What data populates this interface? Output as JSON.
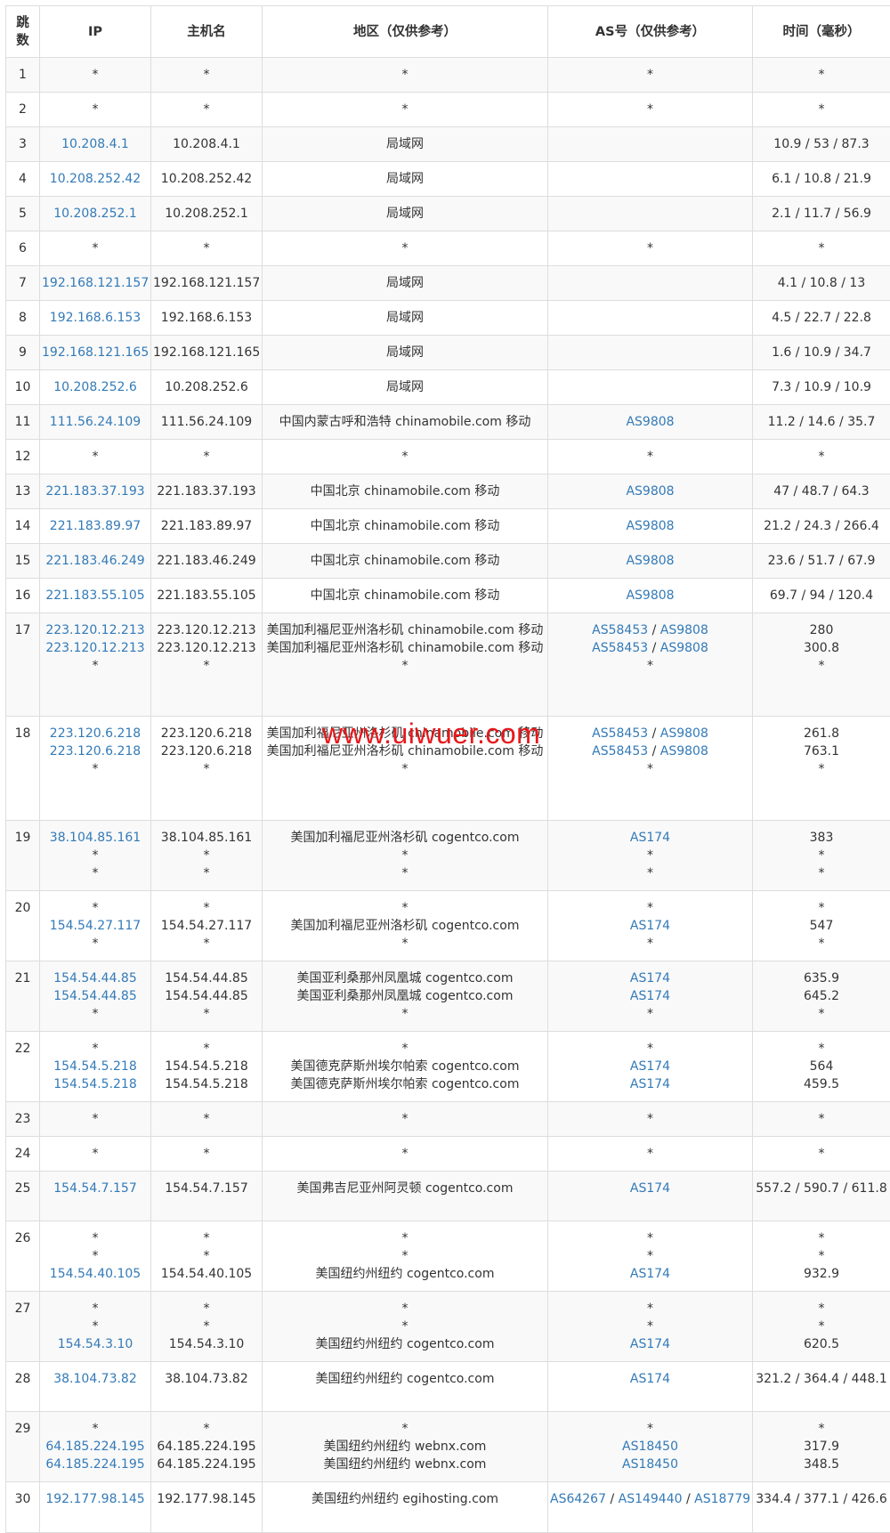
{
  "headers": {
    "hop": "跳数",
    "ip": "IP",
    "hostname": "主机名",
    "region": "地区（仅供参考）",
    "asn": "AS号（仅供参考）",
    "time": "时间（毫秒）"
  },
  "watermark": "www.uiwuer.com",
  "colors": {
    "link": "#337ab7",
    "border": "#dddddd",
    "stripe": "#f9f9f9",
    "watermark": "#e8181b"
  },
  "rows": [
    {
      "hop": "1",
      "h": 36,
      "ip": [
        "*"
      ],
      "host": [
        "*"
      ],
      "region": [
        "*"
      ],
      "as": [
        [
          "*"
        ]
      ],
      "time": [
        "*"
      ]
    },
    {
      "hop": "2",
      "h": 36,
      "ip": [
        "*"
      ],
      "host": [
        "*"
      ],
      "region": [
        "*"
      ],
      "as": [
        [
          "*"
        ]
      ],
      "time": [
        "*"
      ]
    },
    {
      "hop": "3",
      "h": 36,
      "ip": [
        "10.208.4.1"
      ],
      "host": [
        "10.208.4.1"
      ],
      "region": [
        "局域网"
      ],
      "as": [
        []
      ],
      "time": [
        "10.9 / 53 / 87.3"
      ]
    },
    {
      "hop": "4",
      "h": 36,
      "ip": [
        "10.208.252.42"
      ],
      "host": [
        "10.208.252.42"
      ],
      "region": [
        "局域网"
      ],
      "as": [
        []
      ],
      "time": [
        "6.1 / 10.8 / 21.9"
      ]
    },
    {
      "hop": "5",
      "h": 36,
      "ip": [
        "10.208.252.1"
      ],
      "host": [
        "10.208.252.1"
      ],
      "region": [
        "局域网"
      ],
      "as": [
        []
      ],
      "time": [
        "2.1 / 11.7 / 56.9"
      ]
    },
    {
      "hop": "6",
      "h": 36,
      "ip": [
        "*"
      ],
      "host": [
        "*"
      ],
      "region": [
        "*"
      ],
      "as": [
        [
          "*"
        ]
      ],
      "time": [
        "*"
      ]
    },
    {
      "hop": "7",
      "h": 36,
      "ip": [
        "192.168.121.157"
      ],
      "host": [
        "192.168.121.157"
      ],
      "region": [
        "局域网"
      ],
      "as": [
        []
      ],
      "time": [
        "4.1 / 10.8 / 13"
      ]
    },
    {
      "hop": "8",
      "h": 36,
      "ip": [
        "192.168.6.153"
      ],
      "host": [
        "192.168.6.153"
      ],
      "region": [
        "局域网"
      ],
      "as": [
        []
      ],
      "time": [
        "4.5 / 22.7 / 22.8"
      ]
    },
    {
      "hop": "9",
      "h": 36,
      "ip": [
        "192.168.121.165"
      ],
      "host": [
        "192.168.121.165"
      ],
      "region": [
        "局域网"
      ],
      "as": [
        []
      ],
      "time": [
        "1.6 / 10.9 / 34.7"
      ]
    },
    {
      "hop": "10",
      "h": 36,
      "ip": [
        "10.208.252.6"
      ],
      "host": [
        "10.208.252.6"
      ],
      "region": [
        "局域网"
      ],
      "as": [
        []
      ],
      "time": [
        "7.3 / 10.9 / 10.9"
      ]
    },
    {
      "hop": "11",
      "h": 37,
      "ip": [
        "111.56.24.109"
      ],
      "host": [
        "111.56.24.109"
      ],
      "region": [
        "中国内蒙古呼和浩特 chinamobile.com 移动"
      ],
      "as": [
        [
          "AS9808"
        ]
      ],
      "time": [
        "11.2 / 14.6 / 35.7"
      ]
    },
    {
      "hop": "12",
      "h": 36,
      "ip": [
        "*"
      ],
      "host": [
        "*"
      ],
      "region": [
        "*"
      ],
      "as": [
        [
          "*"
        ]
      ],
      "time": [
        "*"
      ]
    },
    {
      "hop": "13",
      "h": 37,
      "ip": [
        "221.183.37.193"
      ],
      "host": [
        "221.183.37.193"
      ],
      "region": [
        "中国北京 chinamobile.com 移动"
      ],
      "as": [
        [
          "AS9808"
        ]
      ],
      "time": [
        "47 / 48.7 / 64.3"
      ]
    },
    {
      "hop": "14",
      "h": 36,
      "ip": [
        "221.183.89.97"
      ],
      "host": [
        "221.183.89.97"
      ],
      "region": [
        "中国北京 chinamobile.com 移动"
      ],
      "as": [
        [
          "AS9808"
        ]
      ],
      "time": [
        "21.2 / 24.3 / 266.4"
      ]
    },
    {
      "hop": "15",
      "h": 37,
      "ip": [
        "221.183.46.249"
      ],
      "host": [
        "221.183.46.249"
      ],
      "region": [
        "中国北京 chinamobile.com 移动"
      ],
      "as": [
        [
          "AS9808"
        ]
      ],
      "time": [
        "23.6 / 51.7 / 67.9"
      ]
    },
    {
      "hop": "16",
      "h": 36,
      "ip": [
        "221.183.55.105"
      ],
      "host": [
        "221.183.55.105"
      ],
      "region": [
        "中国北京 chinamobile.com 移动"
      ],
      "as": [
        [
          "AS9808"
        ]
      ],
      "time": [
        "69.7 / 94 / 120.4"
      ]
    },
    {
      "hop": "17",
      "h": 116,
      "ip": [
        "223.120.12.213",
        "223.120.12.213",
        "*"
      ],
      "host": [
        "223.120.12.213",
        "223.120.12.213",
        "*"
      ],
      "region": [
        "美国加利福尼亚州洛杉矶 chinamobile.com 移动",
        "美国加利福尼亚州洛杉矶 chinamobile.com 移动",
        "*"
      ],
      "as": [
        [
          "AS58453",
          "AS9808"
        ],
        [
          "AS58453",
          "AS9808"
        ],
        [
          "*"
        ]
      ],
      "time": [
        "280",
        "300.8",
        "*"
      ]
    },
    {
      "hop": "18",
      "h": 117,
      "ip": [
        "223.120.6.218",
        "223.120.6.218",
        "*"
      ],
      "host": [
        "223.120.6.218",
        "223.120.6.218",
        "*"
      ],
      "region": [
        "美国加利福尼亚州洛杉矶 chinamobile.com 移动",
        "美国加利福尼亚州洛杉矶 chinamobile.com 移动",
        "*"
      ],
      "as": [
        [
          "AS58453",
          "AS9808"
        ],
        [
          "AS58453",
          "AS9808"
        ],
        [
          "*"
        ]
      ],
      "time": [
        "261.8",
        "763.1",
        "*"
      ]
    },
    {
      "hop": "19",
      "h": 76,
      "ip": [
        "38.104.85.161",
        "*",
        "*"
      ],
      "host": [
        "38.104.85.161",
        "*",
        "*"
      ],
      "region": [
        "美国加利福尼亚州洛杉矶 cogentco.com",
        "*",
        "*"
      ],
      "as": [
        [
          "AS174"
        ],
        [
          "*"
        ],
        [
          "*"
        ]
      ],
      "time": [
        "383",
        "*",
        "*"
      ]
    },
    {
      "hop": "20",
      "h": 77,
      "ip": [
        "*",
        "154.54.27.117",
        "*"
      ],
      "host": [
        "*",
        "154.54.27.117",
        "*"
      ],
      "region": [
        "*",
        "美国加利福尼亚州洛杉矶 cogentco.com",
        "*"
      ],
      "as": [
        [
          "*"
        ],
        [
          "AS174"
        ],
        [
          "*"
        ]
      ],
      "time": [
        "*",
        "547",
        "*"
      ]
    },
    {
      "hop": "21",
      "h": 77,
      "ip": [
        "154.54.44.85",
        "154.54.44.85",
        "*"
      ],
      "host": [
        "154.54.44.85",
        "154.54.44.85",
        "*"
      ],
      "region": [
        "美国亚利桑那州凤凰城 cogentco.com",
        "美国亚利桑那州凤凰城 cogentco.com",
        "*"
      ],
      "as": [
        [
          "AS174"
        ],
        [
          "AS174"
        ],
        [
          "*"
        ]
      ],
      "time": [
        "635.9",
        "645.2",
        "*"
      ]
    },
    {
      "hop": "22",
      "h": 76,
      "ip": [
        "*",
        "154.54.5.218",
        "154.54.5.218"
      ],
      "host": [
        "*",
        "154.54.5.218",
        "154.54.5.218"
      ],
      "region": [
        "*",
        "美国德克萨斯州埃尔帕索 cogentco.com",
        "美国德克萨斯州埃尔帕索 cogentco.com"
      ],
      "as": [
        [
          "*"
        ],
        [
          "AS174"
        ],
        [
          "AS174"
        ]
      ],
      "time": [
        "*",
        "564",
        "459.5"
      ]
    },
    {
      "hop": "23",
      "h": 37,
      "ip": [
        "*"
      ],
      "host": [
        "*"
      ],
      "region": [
        "*"
      ],
      "as": [
        [
          "*"
        ]
      ],
      "time": [
        "*"
      ]
    },
    {
      "hop": "24",
      "h": 36,
      "ip": [
        "*"
      ],
      "host": [
        "*"
      ],
      "region": [
        "*"
      ],
      "as": [
        [
          "*"
        ]
      ],
      "time": [
        "*"
      ]
    },
    {
      "hop": "25",
      "h": 56,
      "ip": [
        "154.54.7.157"
      ],
      "host": [
        "154.54.7.157"
      ],
      "region": [
        "美国弗吉尼亚州阿灵顿 cogentco.com"
      ],
      "as": [
        [
          "AS174"
        ]
      ],
      "time": [
        "557.2 / 590.7 / 611.8"
      ]
    },
    {
      "hop": "26",
      "h": 77,
      "ip": [
        "*",
        "*",
        "154.54.40.105"
      ],
      "host": [
        "*",
        "*",
        "154.54.40.105"
      ],
      "region": [
        "*",
        "*",
        "美国纽约州纽约 cogentco.com"
      ],
      "as": [
        [
          "*"
        ],
        [
          "*"
        ],
        [
          "AS174"
        ]
      ],
      "time": [
        "*",
        "*",
        "932.9"
      ]
    },
    {
      "hop": "27",
      "h": 76,
      "ip": [
        "*",
        "*",
        "154.54.3.10"
      ],
      "host": [
        "*",
        "*",
        "154.54.3.10"
      ],
      "region": [
        "*",
        "*",
        "美国纽约州纽约 cogentco.com"
      ],
      "as": [
        [
          "*"
        ],
        [
          "*"
        ],
        [
          "AS174"
        ]
      ],
      "time": [
        "*",
        "*",
        "620.5"
      ]
    },
    {
      "hop": "28",
      "h": 56,
      "ip": [
        "38.104.73.82"
      ],
      "host": [
        "38.104.73.82"
      ],
      "region": [
        "美国纽约州纽约 cogentco.com"
      ],
      "as": [
        [
          "AS174"
        ]
      ],
      "time": [
        "321.2 / 364.4 / 448.1"
      ]
    },
    {
      "hop": "29",
      "h": 77,
      "ip": [
        "*",
        "64.185.224.195",
        "64.185.224.195"
      ],
      "host": [
        "*",
        "64.185.224.195",
        "64.185.224.195"
      ],
      "region": [
        "*",
        "美国纽约州纽约 webnx.com",
        "美国纽约州纽约 webnx.com"
      ],
      "as": [
        [
          "*"
        ],
        [
          "AS18450"
        ],
        [
          "AS18450"
        ]
      ],
      "time": [
        "*",
        "317.9",
        "348.5"
      ]
    },
    {
      "hop": "30",
      "h": 57,
      "ip": [
        "192.177.98.145"
      ],
      "host": [
        "192.177.98.145"
      ],
      "region": [
        "美国纽约州纽约 egihosting.com"
      ],
      "as": [
        [
          "AS64267",
          "AS149440",
          "AS18779"
        ]
      ],
      "time": [
        "334.4 / 377.1 / 426.6"
      ]
    }
  ]
}
